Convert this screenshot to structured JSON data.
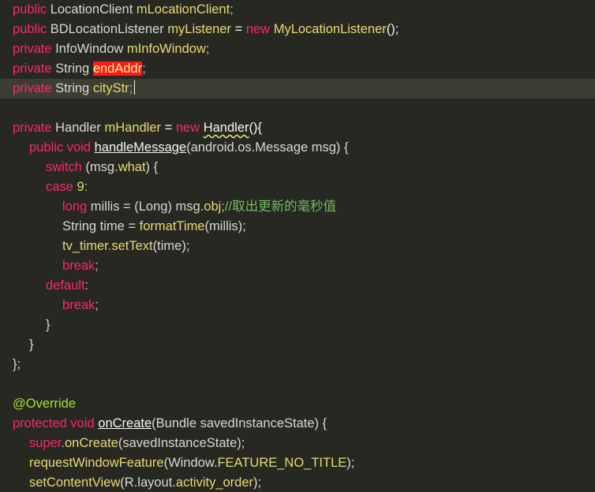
{
  "editor": {
    "language": "java",
    "cursor_line": 4,
    "selected_token": "endAddr",
    "lines": [
      {
        "indent": 0,
        "tokens": [
          {
            "t": "public",
            "c": "kw"
          },
          {
            "t": " LocationClient ",
            "c": "type"
          },
          {
            "t": "mLocationClient",
            "c": "ident"
          },
          {
            "t": ";",
            "c": "punct"
          }
        ]
      },
      {
        "indent": 0,
        "tokens": [
          {
            "t": "public",
            "c": "kw"
          },
          {
            "t": " BDLocationListener ",
            "c": "type"
          },
          {
            "t": "myListener",
            "c": "ident"
          },
          {
            "t": " = ",
            "c": "plain"
          },
          {
            "t": "new",
            "c": "kw"
          },
          {
            "t": " ",
            "c": "plain"
          },
          {
            "t": "MyLocationListener",
            "c": "ident"
          },
          {
            "t": "();",
            "c": "plain"
          }
        ]
      },
      {
        "indent": 0,
        "tokens": [
          {
            "t": "private",
            "c": "kw"
          },
          {
            "t": " InfoWindow ",
            "c": "type"
          },
          {
            "t": "mInfoWindow",
            "c": "ident"
          },
          {
            "t": ";",
            "c": "punct"
          }
        ]
      },
      {
        "indent": 0,
        "tokens": [
          {
            "t": "private",
            "c": "kw"
          },
          {
            "t": " String ",
            "c": "type"
          },
          {
            "t": "endAddr",
            "c": "sel"
          },
          {
            "t": ";",
            "c": "punct"
          }
        ]
      },
      {
        "indent": 0,
        "cursor": true,
        "tokens": [
          {
            "t": "private",
            "c": "kw"
          },
          {
            "t": " String ",
            "c": "type"
          },
          {
            "t": "cityStr",
            "c": "ident"
          },
          {
            "t": ";",
            "c": "punct"
          }
        ]
      },
      {
        "indent": 0,
        "tokens": []
      },
      {
        "indent": 0,
        "tokens": [
          {
            "t": "private",
            "c": "kw"
          },
          {
            "t": " Handler ",
            "c": "type"
          },
          {
            "t": "mHandler",
            "c": "ident"
          },
          {
            "t": " = ",
            "c": "plain"
          },
          {
            "t": "new",
            "c": "kw"
          },
          {
            "t": " ",
            "c": "plain"
          },
          {
            "t": "Handler",
            "c": "warn"
          },
          {
            "t": "(){",
            "c": "plain"
          }
        ]
      },
      {
        "indent": 1,
        "tokens": [
          {
            "t": "public",
            "c": "kw"
          },
          {
            "t": " ",
            "c": "plain"
          },
          {
            "t": "void",
            "c": "kw"
          },
          {
            "t": " ",
            "c": "plain"
          },
          {
            "t": "handleMessage",
            "c": "ulink"
          },
          {
            "t": "(android.os.Message msg) {",
            "c": "type"
          }
        ]
      },
      {
        "indent": 2,
        "tokens": [
          {
            "t": "switch",
            "c": "kw"
          },
          {
            "t": " (msg.",
            "c": "type"
          },
          {
            "t": "what",
            "c": "ident"
          },
          {
            "t": ") {",
            "c": "type"
          }
        ]
      },
      {
        "indent": 2,
        "tokens": [
          {
            "t": "case",
            "c": "kw"
          },
          {
            "t": " ",
            "c": "plain"
          },
          {
            "t": "9",
            "c": "num"
          },
          {
            "t": ":",
            "c": "punct"
          }
        ]
      },
      {
        "indent": 3,
        "tokens": [
          {
            "t": "long",
            "c": "kw"
          },
          {
            "t": " millis = (Long) msg.",
            "c": "type"
          },
          {
            "t": "obj",
            "c": "ident"
          },
          {
            "t": ";",
            "c": "punct"
          },
          {
            "t": "//取出更新的毫秒值",
            "c": "comment"
          }
        ]
      },
      {
        "indent": 3,
        "tokens": [
          {
            "t": "String time = ",
            "c": "type"
          },
          {
            "t": "formatTime",
            "c": "ident"
          },
          {
            "t": "(millis);",
            "c": "type"
          }
        ]
      },
      {
        "indent": 3,
        "tokens": [
          {
            "t": "tv_timer",
            "c": "ident"
          },
          {
            "t": ".",
            "c": "punct"
          },
          {
            "t": "setText",
            "c": "ident"
          },
          {
            "t": "(time);",
            "c": "type"
          }
        ]
      },
      {
        "indent": 3,
        "tokens": [
          {
            "t": "break",
            "c": "kw"
          },
          {
            "t": ";",
            "c": "punct"
          }
        ]
      },
      {
        "indent": 2,
        "tokens": [
          {
            "t": "default",
            "c": "kw"
          },
          {
            "t": ":",
            "c": "punct"
          }
        ]
      },
      {
        "indent": 3,
        "tokens": [
          {
            "t": "break",
            "c": "kw"
          },
          {
            "t": ";",
            "c": "punct"
          }
        ]
      },
      {
        "indent": 2,
        "tokens": [
          {
            "t": "}",
            "c": "type"
          }
        ]
      },
      {
        "indent": 1,
        "tokens": [
          {
            "t": "}",
            "c": "type"
          }
        ]
      },
      {
        "indent": 0,
        "tokens": [
          {
            "t": "};",
            "c": "type"
          }
        ]
      },
      {
        "indent": 0,
        "tokens": []
      },
      {
        "indent": 0,
        "tokens": [
          {
            "t": "@Override",
            "c": "anno"
          }
        ]
      },
      {
        "indent": 0,
        "tokens": [
          {
            "t": "protected",
            "c": "kw"
          },
          {
            "t": " ",
            "c": "plain"
          },
          {
            "t": "void",
            "c": "kw"
          },
          {
            "t": " ",
            "c": "plain"
          },
          {
            "t": "onCreate",
            "c": "ulink"
          },
          {
            "t": "(Bundle savedInstanceState) {",
            "c": "type"
          }
        ]
      },
      {
        "indent": 1,
        "tokens": [
          {
            "t": "super",
            "c": "kw"
          },
          {
            "t": ".",
            "c": "punct"
          },
          {
            "t": "onCreate",
            "c": "ident"
          },
          {
            "t": "(savedInstanceState);",
            "c": "type"
          }
        ]
      },
      {
        "indent": 1,
        "tokens": [
          {
            "t": "requestWindowFeature",
            "c": "ident"
          },
          {
            "t": "(Window.",
            "c": "type"
          },
          {
            "t": "FEATURE_NO_TITLE",
            "c": "ident"
          },
          {
            "t": ");",
            "c": "type"
          }
        ]
      },
      {
        "indent": 1,
        "tokens": [
          {
            "t": "setContentView",
            "c": "ident"
          },
          {
            "t": "(R.layout.",
            "c": "type"
          },
          {
            "t": "activity_order",
            "c": "ident"
          },
          {
            "t": ");",
            "c": "type"
          }
        ]
      }
    ]
  },
  "colors": {
    "background": "#272822",
    "keyword": "#f92672",
    "identifier": "#e6db74",
    "comment": "#75b960",
    "annotation": "#a6e22e",
    "selection": "#ff1a1a",
    "cursor_line": "#3e3d32"
  }
}
